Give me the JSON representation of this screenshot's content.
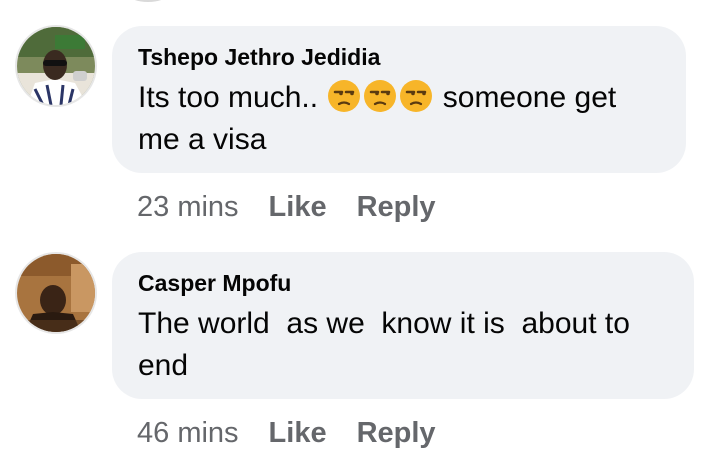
{
  "comments": [
    {
      "author": "Tshepo Jethro Jedidia",
      "text_before": "Its too much.. ",
      "emojis": [
        "unamused-face",
        "unamused-face",
        "unamused-face"
      ],
      "text_after": " someone get",
      "text_line2": "me a visa",
      "time": "23 mins",
      "like_label": "Like",
      "reply_label": "Reply"
    },
    {
      "author": "Casper Mpofu",
      "text_line1": "The world  as we  know it is  about to",
      "text_line2": "end",
      "time": "46 mins",
      "like_label": "Like",
      "reply_label": "Reply"
    }
  ],
  "colors": {
    "bubble_bg": "#f0f2f5",
    "text": "#050505",
    "meta": "#65676b",
    "emoji_face": "#f7b529"
  }
}
